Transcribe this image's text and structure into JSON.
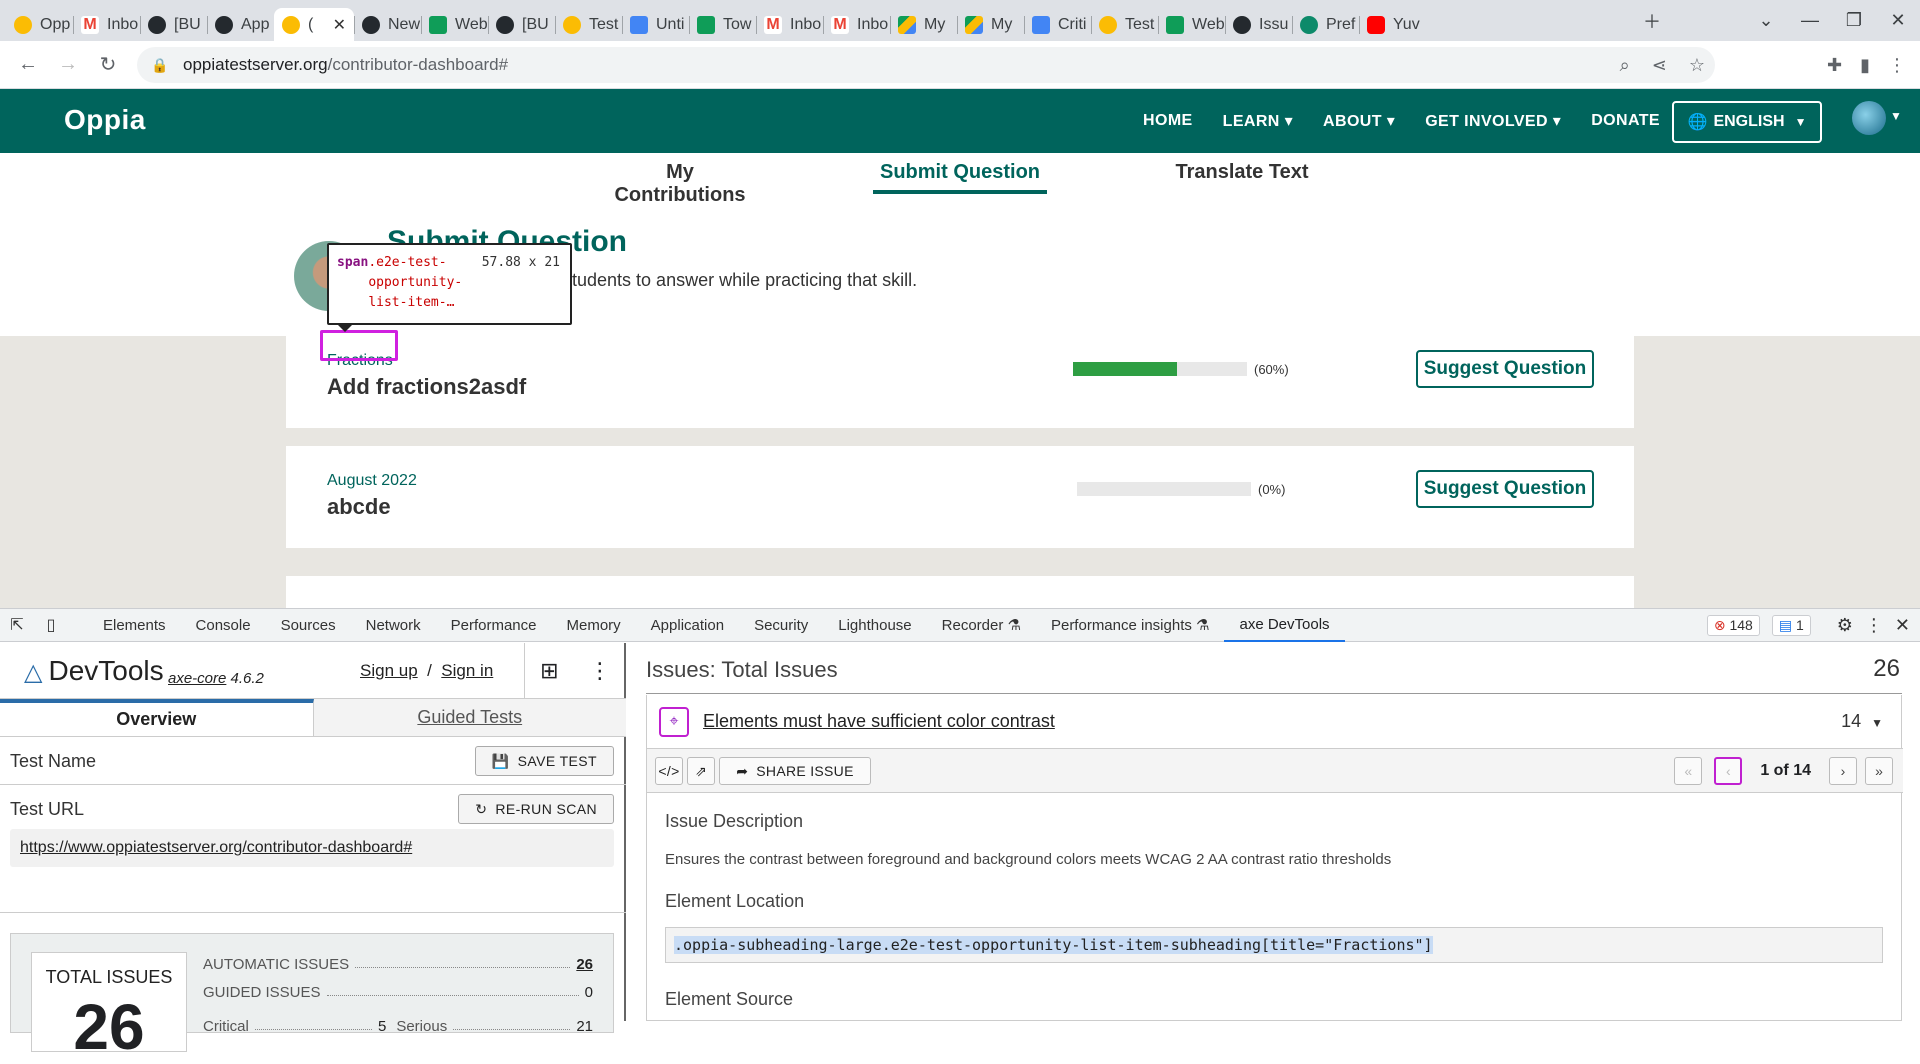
{
  "browser": {
    "tabs": [
      {
        "icon": "bulb",
        "label": "Opp"
      },
      {
        "icon": "gmail",
        "label": "Inbo"
      },
      {
        "icon": "gh",
        "label": "[BU"
      },
      {
        "icon": "gh",
        "label": "App"
      },
      {
        "icon": "bulb",
        "label": "(",
        "active": true
      },
      {
        "icon": "gh",
        "label": "New"
      },
      {
        "icon": "sheets",
        "label": "Web"
      },
      {
        "icon": "gh",
        "label": "[BU"
      },
      {
        "icon": "bulb",
        "label": "Test"
      },
      {
        "icon": "docs",
        "label": "Unti"
      },
      {
        "icon": "sheets",
        "label": "Tow"
      },
      {
        "icon": "gmail",
        "label": "Inbo"
      },
      {
        "icon": "gmail",
        "label": "Inbo"
      },
      {
        "icon": "drive",
        "label": "My"
      },
      {
        "icon": "drive",
        "label": "My"
      },
      {
        "icon": "docs",
        "label": "Criti"
      },
      {
        "icon": "bulb",
        "label": "Test"
      },
      {
        "icon": "sheets",
        "label": "Web"
      },
      {
        "icon": "gh",
        "label": "Issu"
      },
      {
        "icon": "oppia",
        "label": "Pref"
      },
      {
        "icon": "yt",
        "label": "Yuv"
      }
    ],
    "url_host": "oppiatestserver.org",
    "url_path": "/contributor-dashboard#"
  },
  "oppia": {
    "logo": "Oppia",
    "nav": [
      "HOME",
      "LEARN ▾",
      "ABOUT ▾",
      "GET INVOLVED ▾",
      "DONATE"
    ],
    "language": "ENGLISH",
    "tabs": [
      "My Contributions",
      "Submit Question",
      "Translate Text"
    ],
    "title": "Submit Question",
    "desc": "tudents to answer while practicing that skill.",
    "cards": [
      {
        "sub": "Fractions",
        "name": "Add fractions2asdf",
        "progress": 60,
        "pct": "(60%)",
        "button": "Suggest Question"
      },
      {
        "sub": "August 2022",
        "name": "abcde",
        "progress": 0,
        "pct": "(0%)",
        "button": "Suggest Question"
      }
    ],
    "tooltip": {
      "tag": "span",
      "cls1": ".e2e-test-",
      "cls2": "opportunity-",
      "cls3": "list-item-…",
      "dims": "57.88 x 21"
    }
  },
  "devtools": {
    "tabs": [
      "Elements",
      "Console",
      "Sources",
      "Network",
      "Performance",
      "Memory",
      "Application",
      "Security",
      "Lighthouse",
      "Recorder ⚗",
      "Performance insights ⚗",
      "axe DevTools"
    ],
    "errors": "148",
    "messages": "1",
    "axe": {
      "brand": "DevTools",
      "version_label": "axe-core",
      "version": "4.6.2",
      "sign_up": "Sign up",
      "sign_in": "Sign in",
      "overview_tab": "Overview",
      "guided_tab": "Guided Tests",
      "test_name_label": "Test Name",
      "save_test": "SAVE TEST",
      "test_url_label": "Test URL",
      "rerun": "RE-RUN SCAN",
      "test_url": "https://www.oppiatestserver.org/contributor-dashboard#",
      "total_label": "TOTAL ISSUES",
      "total": "26",
      "automatic_label": "AUTOMATIC ISSUES",
      "automatic": "26",
      "guided_label": "GUIDED ISSUES",
      "guided": "0",
      "critical_label": "Critical",
      "critical": "5",
      "serious_label": "Serious",
      "serious": "21"
    },
    "issues": {
      "header": "Issues: Total Issues",
      "count": "26",
      "title": "Elements must have sufficient color contrast",
      "num": "14",
      "share": "SHARE ISSUE",
      "page_of": "1 of 14",
      "desc_label": "Issue Description",
      "desc": "Ensures the contrast between foreground and background colors meets WCAG 2 AA contrast ratio thresholds",
      "loc_label": "Element Location",
      "loc": ".oppia-subheading-large.e2e-test-opportunity-list-item-subheading[title=\"Fractions\"]",
      "source_label": "Element Source"
    }
  }
}
